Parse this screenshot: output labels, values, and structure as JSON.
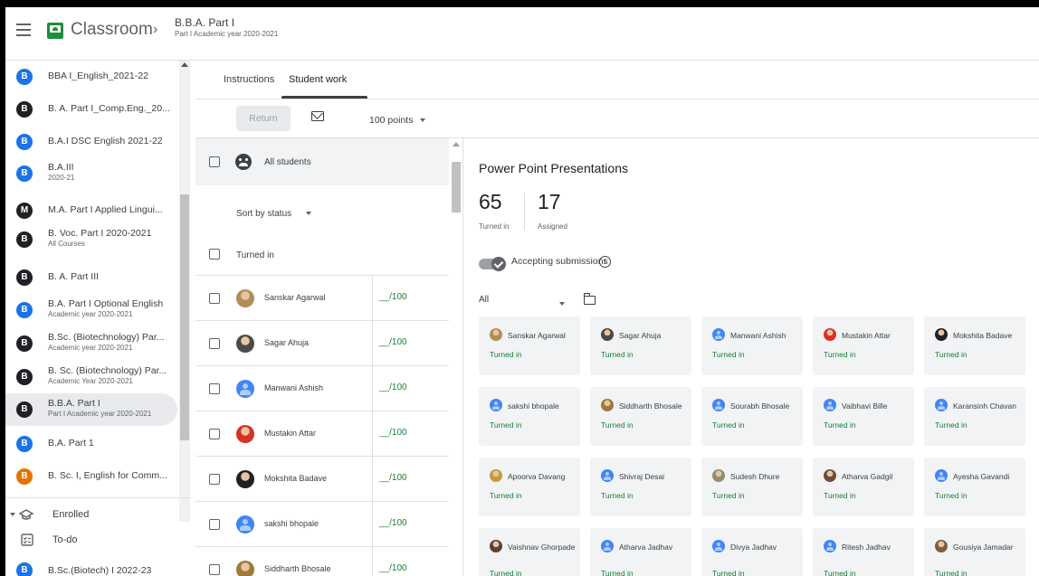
{
  "header": {
    "app_name": "Classroom",
    "crumb_sep": "›",
    "class_title": "B.B.A. Part I",
    "class_subtitle": "Part I Academic year 2020-2021"
  },
  "sidebar": {
    "classes": [
      {
        "initial": "B",
        "color": "#1a73e8",
        "name": "BBA I_English_2021-22",
        "sub": ""
      },
      {
        "initial": "B",
        "color": "#202124",
        "name": "B. A. Part I_Comp.Eng._20...",
        "sub": ""
      },
      {
        "initial": "B",
        "color": "#1a73e8",
        "name": "B.A.I DSC English 2021-22",
        "sub": ""
      },
      {
        "initial": "B",
        "color": "#1a73e8",
        "name": "B.A.III",
        "sub": "2020-21"
      },
      {
        "initial": "M",
        "color": "#202124",
        "name": "M.A. Part I Applied Lingui...",
        "sub": ""
      },
      {
        "initial": "B",
        "color": "#202124",
        "name": "B. Voc. Part I 2020-2021",
        "sub": "All Courses"
      },
      {
        "initial": "B",
        "color": "#202124",
        "name": "B. A. Part III",
        "sub": ""
      },
      {
        "initial": "B",
        "color": "#1a73e8",
        "name": "B.A. Part I Optional English",
        "sub": "Academic year 2020-2021"
      },
      {
        "initial": "B",
        "color": "#202124",
        "name": "B.Sc. (Biotechnology) Par...",
        "sub": "Academic year 2020-2021"
      },
      {
        "initial": "B",
        "color": "#202124",
        "name": "B. Sc. (Biotechnology) Par...",
        "sub": "Academic Year 2020-2021"
      },
      {
        "initial": "B",
        "color": "#202124",
        "name": "B.B.A. Part I",
        "sub": "Part I Academic year 2020-2021"
      },
      {
        "initial": "B",
        "color": "#1a73e8",
        "name": "B.A. Part 1",
        "sub": ""
      },
      {
        "initial": "B",
        "color": "#e37400",
        "name": "B. Sc. I, English for Comm...",
        "sub": ""
      }
    ],
    "enrolled_label": "Enrolled",
    "todo_label": "To-do",
    "last_class": {
      "initial": "B",
      "color": "#1a73e8",
      "name": "B.Sc.(Biotech) I 2022-23"
    }
  },
  "tabs": {
    "instructions": "Instructions",
    "student_work": "Student work"
  },
  "toolbar": {
    "return_label": "Return",
    "points_label": "100 points"
  },
  "list": {
    "all_students": "All students",
    "sort_label": "Sort by status",
    "turned_in_header": "Turned in",
    "students": [
      {
        "name": "Sanskar Agarwal",
        "grade": "__/100",
        "avatar": "photo",
        "color": "#b08d57"
      },
      {
        "name": "Sagar Ahuja",
        "grade": "__/100",
        "avatar": "photo",
        "color": "#4a4a4a"
      },
      {
        "name": "Manwani Ashish",
        "grade": "__/100",
        "avatar": "default",
        "color": "#4285f4"
      },
      {
        "name": "Mustakin Attar",
        "grade": "__/100",
        "avatar": "photo",
        "color": "#d93025"
      },
      {
        "name": "Mokshita Badave",
        "grade": "__/100",
        "avatar": "photo",
        "color": "#202124"
      },
      {
        "name": "sakshi bhopale",
        "grade": "__/100",
        "avatar": "default",
        "color": "#4285f4"
      },
      {
        "name": "Siddharth Bhosale",
        "grade": "__/100",
        "avatar": "photo",
        "color": "#9c7a3c"
      }
    ]
  },
  "detail": {
    "title": "Power Point Presentations",
    "turned_in_count": "65",
    "turned_in_label": "Turned in",
    "assigned_count": "17",
    "assigned_label": "Assigned",
    "accepting_label": "Accepting submissions",
    "accepting": true,
    "info_glyph": "i",
    "filter_label": "All",
    "cards": [
      {
        "name": "Sanskar Agarwal",
        "status": "Turned in",
        "avatar": "photo",
        "color": "#b08d57"
      },
      {
        "name": "Sagar Ahuja",
        "status": "Turned in",
        "avatar": "photo",
        "color": "#4a4a4a"
      },
      {
        "name": "Manwani Ashish",
        "status": "Turned in",
        "avatar": "default",
        "color": "#4285f4"
      },
      {
        "name": "Mustakin Attar",
        "status": "Turned in",
        "avatar": "photo",
        "color": "#d93025"
      },
      {
        "name": "Mokshita Badave",
        "status": "Turned in",
        "avatar": "photo",
        "color": "#202124"
      },
      {
        "name": "sakshi bhopale",
        "status": "Turned in",
        "avatar": "default",
        "color": "#4285f4"
      },
      {
        "name": "Siddharth Bhosale",
        "status": "Turned in",
        "avatar": "photo",
        "color": "#9c7a3c"
      },
      {
        "name": "Sourabh Bhosale",
        "status": "Turned in",
        "avatar": "default",
        "color": "#4285f4"
      },
      {
        "name": "Vaibhavi Bille",
        "status": "Turned in",
        "avatar": "default",
        "color": "#4285f4"
      },
      {
        "name": "Karansinh Chavan",
        "status": "Turned in",
        "avatar": "default",
        "color": "#4285f4"
      },
      {
        "name": "Apoorva Davang",
        "status": "Turned in",
        "avatar": "photo",
        "color": "#c49a3a"
      },
      {
        "name": "Shivraj Desai",
        "status": "Turned in",
        "avatar": "default",
        "color": "#4285f4"
      },
      {
        "name": "Sudesh Dhure",
        "status": "Turned in",
        "avatar": "photo",
        "color": "#8d8f6e"
      },
      {
        "name": "Atharva Gadgil",
        "status": "Turned in",
        "avatar": "photo",
        "color": "#6b4f3a"
      },
      {
        "name": "Ayesha Gavandi",
        "status": "Turned in",
        "avatar": "default",
        "color": "#4285f4"
      },
      {
        "name": "Vaishnav Ghorpade",
        "status": "Turned in",
        "avatar": "photo",
        "color": "#5d4037"
      },
      {
        "name": "Atharva Jadhav",
        "status": "Turned in",
        "avatar": "default",
        "color": "#4285f4"
      },
      {
        "name": "Divya Jadhav",
        "status": "Turned in",
        "avatar": "default",
        "color": "#4285f4"
      },
      {
        "name": "Ritesh Jadhav",
        "status": "Turned in",
        "avatar": "default",
        "color": "#4285f4"
      },
      {
        "name": "Gousiya Jamadar",
        "status": "Turned in",
        "avatar": "photo",
        "color": "#7b5e3b"
      }
    ]
  }
}
